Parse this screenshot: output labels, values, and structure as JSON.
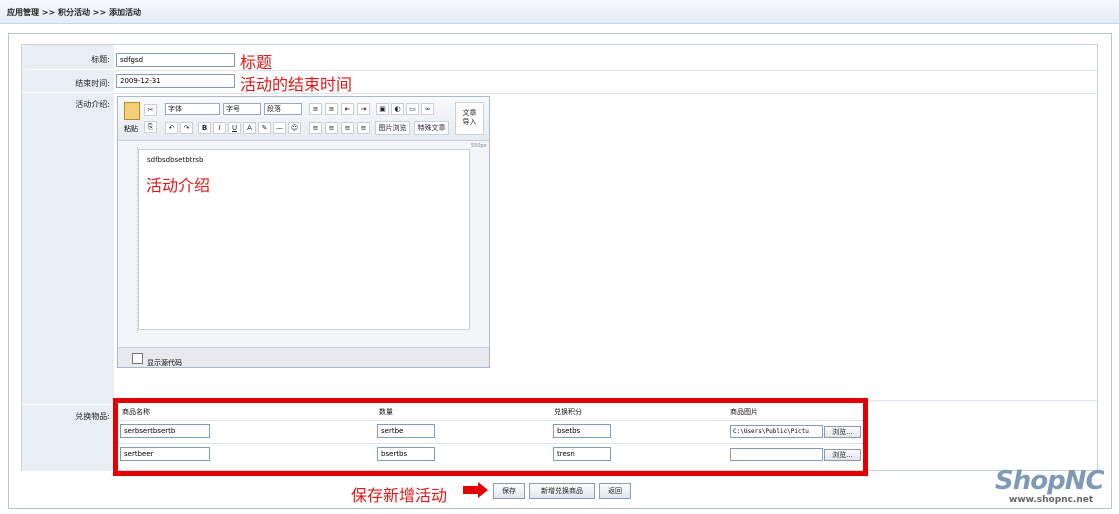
{
  "breadcrumb": "应用管理 >> 积分活动 >> 添加活动",
  "form": {
    "title_label": "标题:",
    "title_value": "sdfgsd",
    "title_annotation": "标题",
    "end_time_label": "结束时间:",
    "end_time_value": "2009-12-31",
    "end_time_annotation": "活动的结束时间",
    "intro_label": "活动介绍:",
    "goods_label": "兑换物品:"
  },
  "editor": {
    "paste_label": "粘贴",
    "font_select": "字体",
    "size_select": "字号",
    "para_select": "段落",
    "bold": "B",
    "italic": "I",
    "underline": "U",
    "image_gallery_button": "图片浏览",
    "special_text_button": "特殊文章",
    "doc_import_button": "文章\n导入",
    "ruler_mark": "550px",
    "content_text": "sdfbsdbsetbtrsb",
    "content_annotation": "活动介绍",
    "show_source_label": "显示源代码"
  },
  "goods": {
    "headers": [
      "商品名称",
      "数量",
      "兑换积分",
      "商品图片"
    ],
    "rows": [
      {
        "name": "serbsertbsertb",
        "qty": "sertbe",
        "points": "bsetbs",
        "image": "C:\\Users\\Public\\Pictu"
      },
      {
        "name": "sertbeer",
        "qty": "bsertbs",
        "points": "tresn",
        "image": ""
      }
    ],
    "browse_label": "浏览..."
  },
  "actions": {
    "annotation": "保存新增活动",
    "save": "保存",
    "add_goods": "新增兑换商品",
    "back": "返回"
  },
  "logo": {
    "main": "ShopNC",
    "sub": "www.shopnc.net"
  },
  "colors": {
    "annotation_red": "#e11818",
    "highlight_red": "#e40000",
    "logo_blue": "#7f99b8"
  }
}
